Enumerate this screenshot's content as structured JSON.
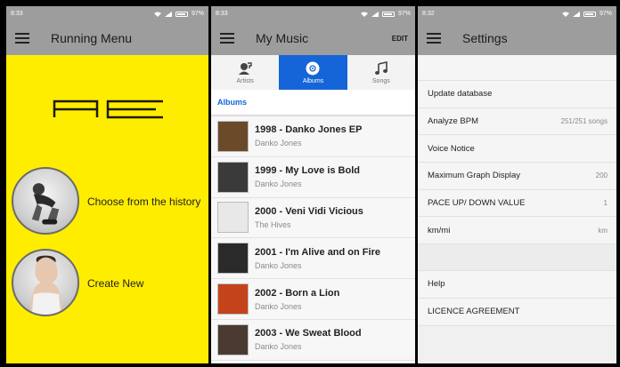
{
  "screen_running": {
    "status": {
      "time": "8:33",
      "battery": "97%"
    },
    "title": "Running Menu",
    "logo_text": "AE",
    "option_history": "Choose from the history",
    "option_new": "Create New"
  },
  "screen_music": {
    "status": {
      "time": "8:33",
      "battery": "97%"
    },
    "title": "My Music",
    "edit": "EDIT",
    "tabs": [
      {
        "label": "Artists",
        "icon": "artist-icon"
      },
      {
        "label": "Albums",
        "icon": "album-icon"
      },
      {
        "label": "Songs",
        "icon": "music-note-icon"
      }
    ],
    "section": "Albums",
    "albums": [
      {
        "title": "1998 - Danko Jones EP",
        "artist": "Danko Jones",
        "cover": "#6b4a2a"
      },
      {
        "title": "1999 - My Love is Bold",
        "artist": "Danko Jones",
        "cover": "#3a3a3a"
      },
      {
        "title": "2000 - Veni Vidi Vicious",
        "artist": "The Hives",
        "cover": "#e8e8e8"
      },
      {
        "title": "2001 - I'm Alive and on Fire",
        "artist": "Danko Jones",
        "cover": "#2a2a2a"
      },
      {
        "title": "2002 - Born a Lion",
        "artist": "Danko Jones",
        "cover": "#c4431a"
      },
      {
        "title": "2003 - We Sweat Blood",
        "artist": "Danko Jones",
        "cover": "#4a3a30"
      }
    ]
  },
  "screen_settings": {
    "status": {
      "time": "8:32",
      "battery": "97%"
    },
    "title": "Settings",
    "rows": [
      {
        "label": "Update database",
        "value": ""
      },
      {
        "label": "Analyze BPM",
        "value": "251/251 songs"
      },
      {
        "label": "Voice Notice",
        "value": ""
      },
      {
        "label": "Maximum Graph Display",
        "value": "200"
      },
      {
        "label": "PACE UP/ DOWN VALUE",
        "value": "1"
      },
      {
        "label": "km/mi",
        "value": "km"
      }
    ],
    "rows2": [
      {
        "label": "Help"
      },
      {
        "label": "LICENCE AGREEMENT"
      }
    ]
  }
}
